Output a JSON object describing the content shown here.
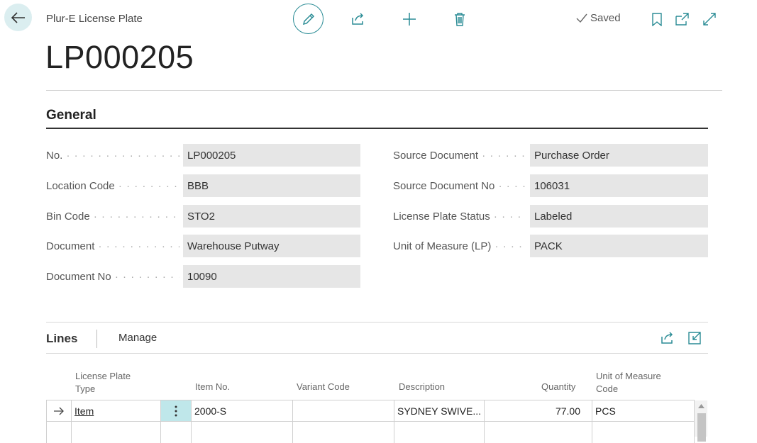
{
  "header": {
    "breadcrumb": "Plur-E License Plate",
    "saved_label": "Saved",
    "title": "LP000205"
  },
  "general": {
    "section_title": "General",
    "left_fields": [
      {
        "label": "No.",
        "value": "LP000205"
      },
      {
        "label": "Location Code",
        "value": "BBB"
      },
      {
        "label": "Bin Code",
        "value": "STO2"
      },
      {
        "label": "Document",
        "value": "Warehouse Putway"
      },
      {
        "label": "Document No",
        "value": "10090"
      }
    ],
    "right_fields": [
      {
        "label": "Source Document",
        "value": "Purchase Order"
      },
      {
        "label": "Source Document No",
        "value": "106031"
      },
      {
        "label": "License Plate Status",
        "value": "Labeled"
      },
      {
        "label": "Unit of Measure (LP)",
        "value": "PACK"
      }
    ]
  },
  "lines": {
    "title": "Lines",
    "manage_label": "Manage",
    "columns": {
      "lp_type_1": "License Plate",
      "lp_type_2": "Type",
      "item_no": "Item No.",
      "variant_code": "Variant Code",
      "description": "Description",
      "quantity": "Quantity",
      "uom_1": "Unit of Measure",
      "uom_2": "Code"
    },
    "rows": [
      {
        "lp_type": "Item",
        "item_no": "2000-S",
        "variant_code": "",
        "description": "SYDNEY SWIVE...",
        "quantity": "77.00",
        "uom": "PCS"
      }
    ]
  },
  "colors": {
    "accent": "#2a8c95",
    "field_bg": "#e6e6e6"
  }
}
